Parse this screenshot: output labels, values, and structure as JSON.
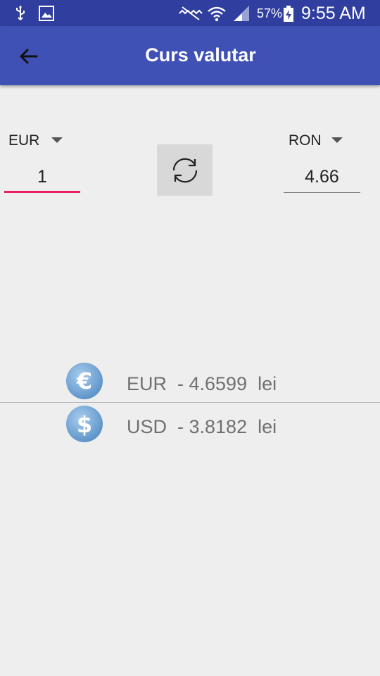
{
  "status_bar": {
    "battery_percent": "57%",
    "time": "9:55 AM"
  },
  "app_bar": {
    "title": "Curs valutar",
    "back_icon": "arrow-left-icon"
  },
  "converter": {
    "from_currency": "EUR",
    "from_amount": "1",
    "to_currency": "RON",
    "to_amount": "4.66",
    "swap_icon": "swap-arrows-icon",
    "accent_color": "#e91e63"
  },
  "rates": [
    {
      "symbol": "€",
      "label": "EUR  - 4.6599  lei"
    },
    {
      "symbol": "$",
      "label": "USD  - 3.8182  lei"
    }
  ],
  "colors": {
    "primary": "#3f51b5",
    "primary_dark": "#303e9f"
  }
}
